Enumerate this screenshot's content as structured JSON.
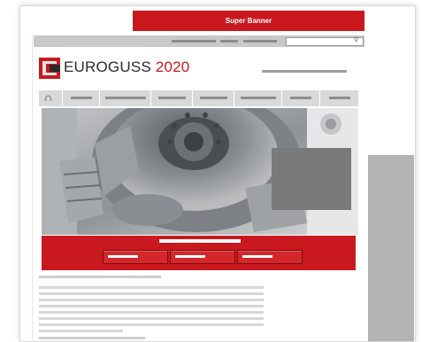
{
  "super_banner": {
    "label": "Super Banner"
  },
  "logo": {
    "name": "EUROGUSS",
    "year": "2020"
  },
  "search": {
    "icon": "search-icon"
  },
  "colors": {
    "brand_red": "#c9191e",
    "placeholder_gray": "#b3b3b3",
    "ad_gray": "#7a7a7a",
    "nav_gray": "#d9d9d9"
  },
  "nav": {
    "home_icon": "headphones-icon",
    "item_count": 7
  },
  "teaser": {
    "button_count": 3
  }
}
